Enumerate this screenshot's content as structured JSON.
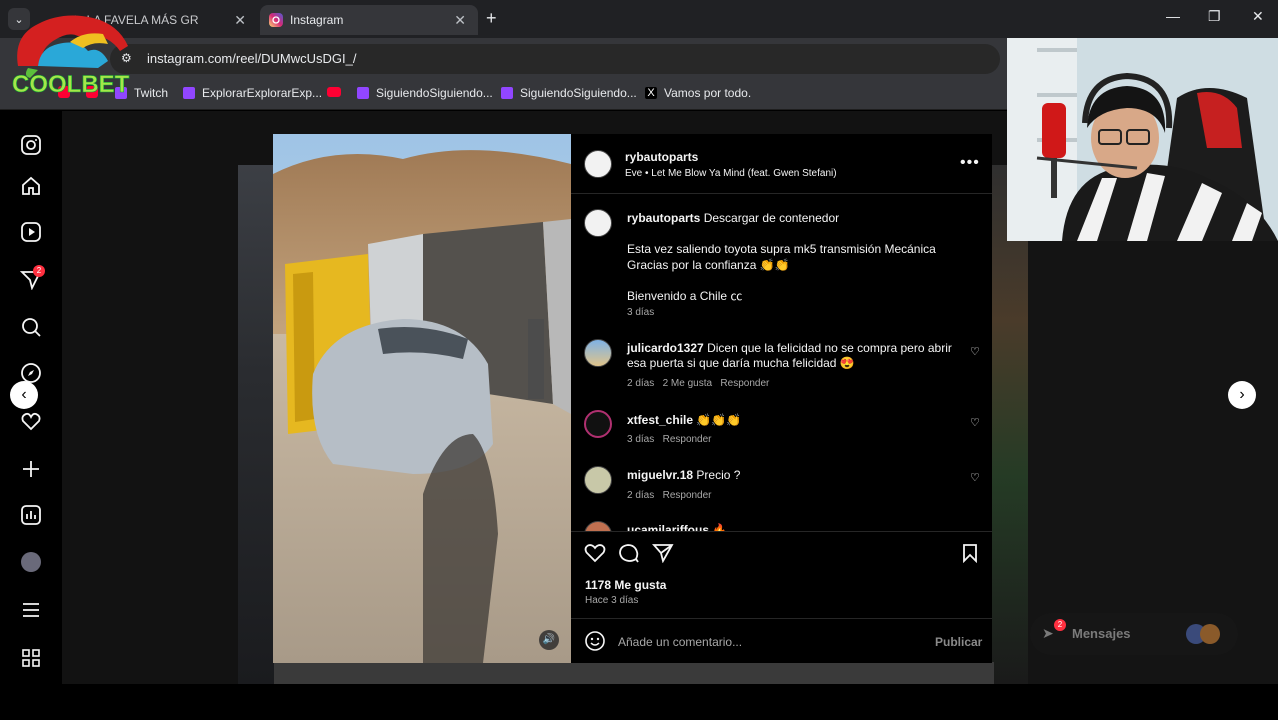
{
  "browser": {
    "tabs": [
      {
        "title": "de LA FAVELA MÁS GR",
        "active": false
      },
      {
        "title": "Instagram",
        "active": true
      }
    ],
    "url": "instagram.com/reel/DUMwcUsDGI_/",
    "bookmarks": [
      {
        "label": "Twitch",
        "icon": "twitch-icon"
      },
      {
        "label": "ExplorarExplorarExp...",
        "icon": "twitch-icon"
      },
      {
        "label": "SiguiendoSiguiendo...",
        "icon": "twitch-icon"
      },
      {
        "label": "SiguiendoSiguiendo...",
        "icon": "twitch-icon"
      },
      {
        "label": "Vamos por todo.",
        "icon": "x-icon"
      }
    ]
  },
  "overlay": {
    "logo_text": "COOLBET"
  },
  "sidebar": {
    "notification_badge": "2"
  },
  "post": {
    "author": "rybautoparts",
    "music": "Eve • Let Me Blow Ya Mind (feat. Gwen Stefani)",
    "caption_author": "rybautoparts",
    "caption_lead": "Descargar de contenedor",
    "caption_body": "Esta vez saliendo toyota supra mk5 transmisión Mecánica Gracias por la confianza 👏👏",
    "caption_footer": "Bienvenido a Chile ㏄",
    "caption_age": "3 días",
    "comments": [
      {
        "user": "julicardo1327",
        "text": "Dicen que la felicidad no se compra pero abrir esa puerta si que daría mucha felicidad 😍",
        "age": "2 días",
        "likes": "2 Me gusta",
        "reply": "Responder"
      },
      {
        "user": "xtfest_chile",
        "text": "👏👏👏",
        "age": "3 días",
        "likes": "",
        "reply": "Responder"
      },
      {
        "user": "miguelvr.18",
        "text": "Precio ?",
        "age": "2 días",
        "likes": "",
        "reply": "Responder"
      },
      {
        "user": "ucamilariffous",
        "text": "🔥",
        "age": "",
        "likes": "",
        "reply": ""
      }
    ],
    "like_count": "1178 Me gusta",
    "posted": "Hace 3 días",
    "comment_placeholder": "Añade un comentario...",
    "publish_label": "Publicar"
  },
  "messages": {
    "label": "Mensajes",
    "badge": "2"
  },
  "colors": {
    "accent": "#0095f6",
    "badge": "#ff3040"
  }
}
